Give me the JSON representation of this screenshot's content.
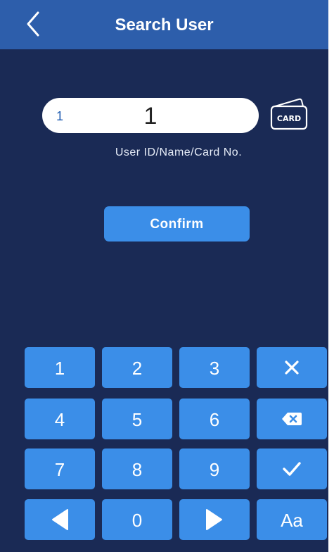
{
  "header": {
    "title": "Search User",
    "back_icon": "chevron-left-icon"
  },
  "search": {
    "prefix": "1",
    "value": "1",
    "hint": "User ID/Name/Card No.",
    "card_icon_label": "CARD"
  },
  "confirm_label": "Confirm",
  "keypad": {
    "k1": "1",
    "k2": "2",
    "k3": "3",
    "k4": "4",
    "k5": "5",
    "k6": "6",
    "k7": "7",
    "k8": "8",
    "k9": "9",
    "k0": "0",
    "case_toggle": "Aa",
    "icons": [
      "close-icon",
      "backspace-icon",
      "check-icon",
      "arrow-left-icon",
      "arrow-right-icon"
    ]
  },
  "colors": {
    "background": "#1a2a55",
    "header": "#2d5eab",
    "key": "#3b8ee8",
    "input_text_prefix": "#1e5bb0"
  }
}
